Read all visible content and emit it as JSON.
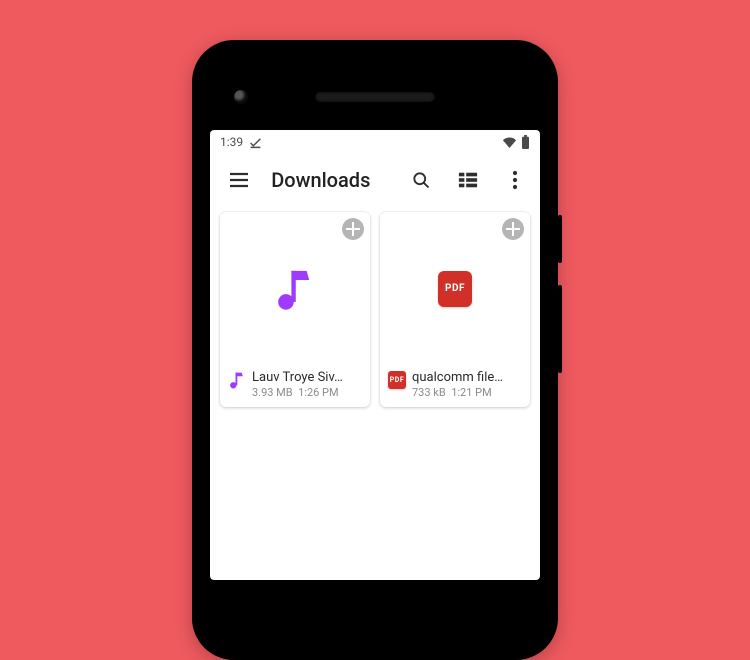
{
  "statusbar": {
    "time": "1:39",
    "icons": {
      "wifi": true,
      "battery": true,
      "check": true
    }
  },
  "appbar": {
    "title": "Downloads"
  },
  "pdf_label": "PDF",
  "files": [
    {
      "kind": "audio",
      "name": "Lauv  Troye Siv…",
      "size": "3.93 MB",
      "time": "1:26 PM"
    },
    {
      "kind": "pdf",
      "name": "qualcomm file…",
      "size": "733 kB",
      "time": "1:21 PM"
    }
  ]
}
